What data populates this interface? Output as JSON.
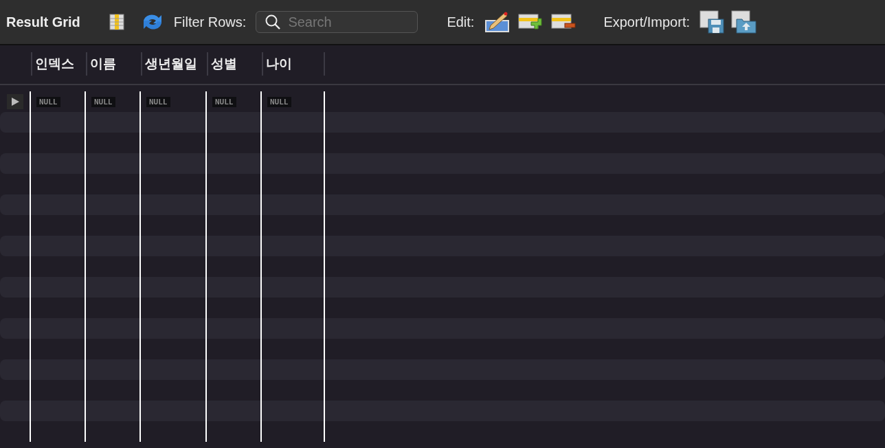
{
  "toolbar": {
    "title": "Result Grid",
    "filter_label": "Filter Rows:",
    "search": {
      "placeholder": "Search"
    },
    "edit_label": "Edit:",
    "export_label": "Export/Import:"
  },
  "table": {
    "columns": [
      "인덱스",
      "이름",
      "생년월일",
      "성별",
      "나이"
    ],
    "rows": [
      {
        "selected": true,
        "cells": [
          "NULL",
          "NULL",
          "NULL",
          "NULL",
          "NULL"
        ]
      }
    ]
  }
}
